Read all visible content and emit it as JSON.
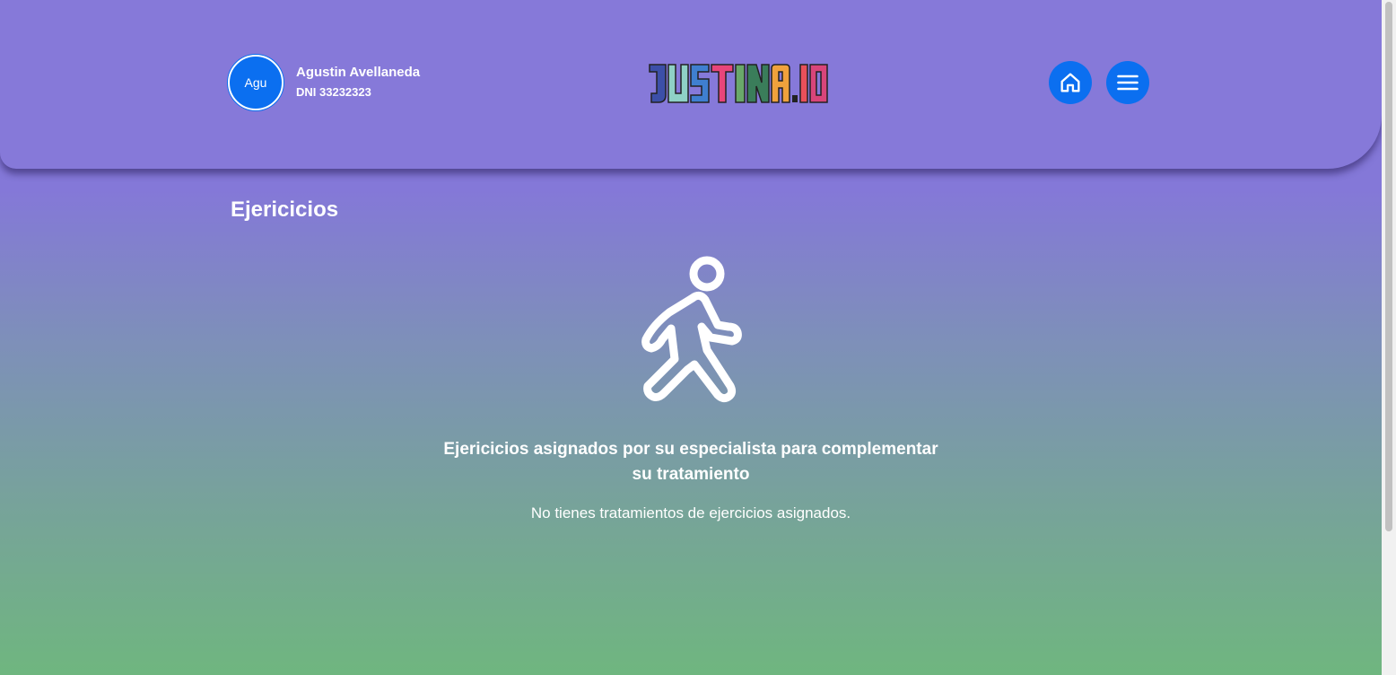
{
  "header": {
    "user": {
      "avatar_initials": "Agu",
      "name": "Agustin Avellaneda",
      "dni": "DNI 33232323"
    },
    "logo": {
      "text": "JUSTINA.IO",
      "letter_colors": [
        "#3c4fa8",
        "#8fd1c6",
        "#3f7fd0",
        "#e8457a",
        "#6aa86a",
        "#d94f8f",
        "#f0a23c",
        "#222222",
        "#e8505a",
        "#d9457a"
      ]
    },
    "home_icon": "home-icon",
    "menu_icon": "hamburger-menu-icon"
  },
  "main": {
    "title": "Ejericicios",
    "icon": "person-walking-icon",
    "subtitle": "Ejericicios asignados por su especialista para complementar su tratamiento",
    "empty_message": "No tienes tratamientos de ejercicios asignados."
  },
  "colors": {
    "header_bg": "#8679d9",
    "accent_blue": "#0b6ff0",
    "gradient_top": "#8478d8",
    "gradient_bottom": "#6fb67f"
  }
}
